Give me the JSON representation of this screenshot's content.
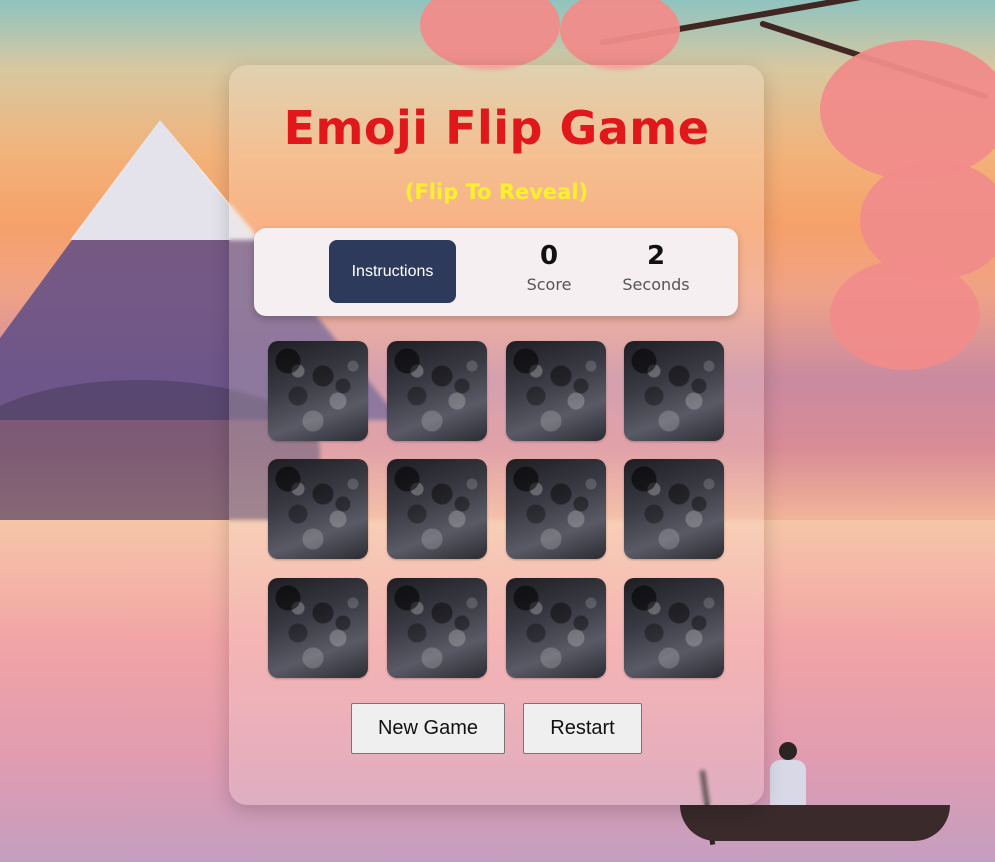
{
  "app": {
    "title": "Emoji Flip Game",
    "subtitle": "(Flip To Reveal)"
  },
  "stats": {
    "instructions_label": "Instructions",
    "score_value": "0",
    "score_label": "Score",
    "seconds_value": "2",
    "seconds_label": "Seconds"
  },
  "board": {
    "rows": 3,
    "columns": 4,
    "cards": [
      {
        "state": "face-down"
      },
      {
        "state": "face-down"
      },
      {
        "state": "face-down"
      },
      {
        "state": "face-down"
      },
      {
        "state": "face-down"
      },
      {
        "state": "face-down"
      },
      {
        "state": "face-down"
      },
      {
        "state": "face-down"
      },
      {
        "state": "face-down"
      },
      {
        "state": "face-down"
      },
      {
        "state": "face-down"
      },
      {
        "state": "face-down"
      }
    ]
  },
  "actions": {
    "new_game_label": "New Game",
    "restart_label": "Restart"
  },
  "colors": {
    "title": "#e0181b",
    "subtitle": "#fff12a",
    "instructions_button": "#2e3a5c",
    "stats_bar": "#f5eff2"
  }
}
